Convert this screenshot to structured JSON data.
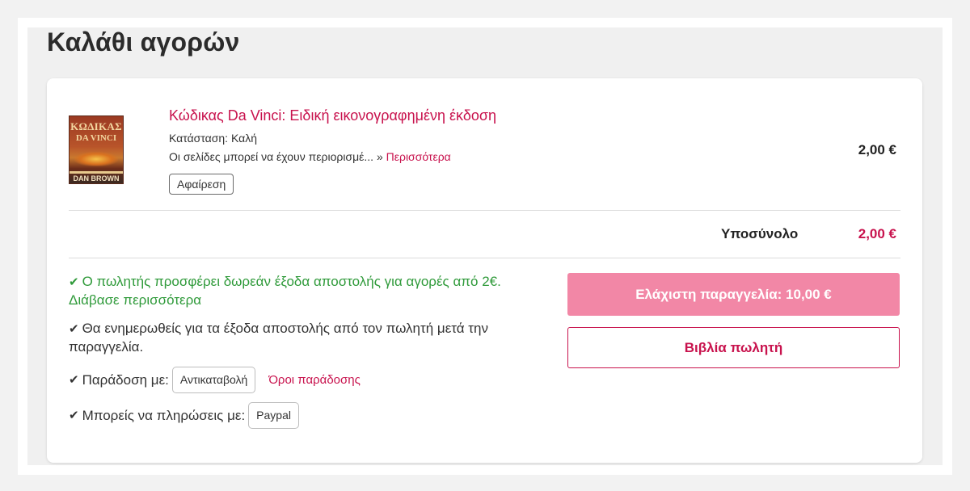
{
  "page": {
    "title": "Καλάθι αγορών"
  },
  "cart": {
    "item": {
      "cover": {
        "line1": "ΚΩΔΙΚΑΣ",
        "line2": "DA VINCI",
        "author": "DAN BROWN"
      },
      "title": "Κώδικας Da Vinci: Ειδική εικονογραφημένη έκδοση",
      "condition": "Κατάσταση: Καλή",
      "description": "Οι σελίδες μπορεί να έχουν περιορισμέ... »",
      "more_link": "Περισσότερα",
      "remove_label": "Αφαίρεση",
      "price": "2,00 €"
    },
    "subtotal": {
      "label": "Υποσύνολο",
      "value": "2,00 €"
    }
  },
  "shipping": {
    "free_shipping_text": "Ο πωλητής προσφέρει δωρεάν έξοδα αποστολής για αγορές από 2€.",
    "read_more": "Διάβασε περισσότερα",
    "notify_text": "Θα ενημερωθείς για τα έξοδα αποστολής από τον πωλητή μετά την παραγγελία.",
    "delivery_label": "Παράδοση με:",
    "delivery_method": "Αντικαταβολή",
    "delivery_terms": "Όροι παράδοσης",
    "payment_label": "Μπορείς να πληρώσεις με:",
    "payment_method": "Paypal"
  },
  "actions": {
    "min_order_label": "Ελάχιστη παραγγελία: 10,00 €",
    "seller_books_label": "Βιβλία πωλητή"
  },
  "colors": {
    "accent": "#c8124d",
    "accent_light": "#f287a6",
    "success": "#2f9a3a"
  }
}
